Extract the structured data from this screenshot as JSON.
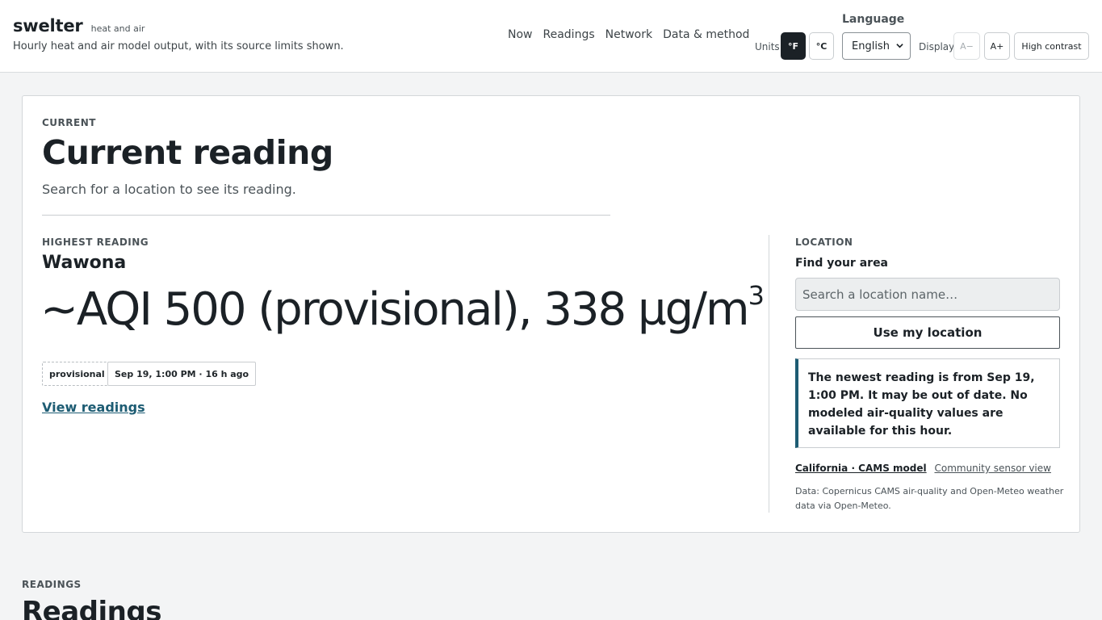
{
  "header": {
    "brand": "swelter",
    "tagline": "heat and air",
    "subtitle": "Hourly heat and air model output, with its source limits shown."
  },
  "nav": [
    {
      "label": "Now"
    },
    {
      "label": "Readings"
    },
    {
      "label": "Network"
    },
    {
      "label": "Data & method"
    }
  ],
  "units": {
    "label": "Units",
    "fahrenheit": "°F",
    "celsius": "°C",
    "selected": "°F"
  },
  "language": {
    "label": "Language",
    "selected": "English"
  },
  "display": {
    "label": "Display",
    "smaller": "A−",
    "larger": "A+",
    "high_contrast": "High contrast"
  },
  "current": {
    "eyebrow": "CURRENT",
    "title": "Current reading",
    "subtitle": "Search for a location to see its reading.",
    "highest": {
      "eyebrow": "HIGHEST READING",
      "place": "Wawona",
      "value": "~AQI 500 (provisional), 338 µg/m",
      "value_sup": "3",
      "chip_status": "provisional",
      "chip_time": "Sep 19, 1:00 PM · 16 h ago",
      "link": "View readings"
    }
  },
  "location": {
    "eyebrow": "LOCATION",
    "title": "Find your area",
    "search_placeholder": "Search a location name…",
    "use_location": "Use my location",
    "notice": "The newest reading is from Sep 19, 1:00 PM. It may be out of date. No modeled air-quality values are available for this hour.",
    "source_active": "California · CAMS model",
    "source_other": "Community sensor view",
    "data_note": "Data: Copernicus CAMS air-quality and Open-Meteo weather data via Open-Meteo."
  },
  "readings": {
    "eyebrow": "READINGS",
    "title": "Readings"
  },
  "colors": {
    "accent": "#1d5c73",
    "ink": "#1b2126",
    "page_bg": "#f3f4f5"
  }
}
